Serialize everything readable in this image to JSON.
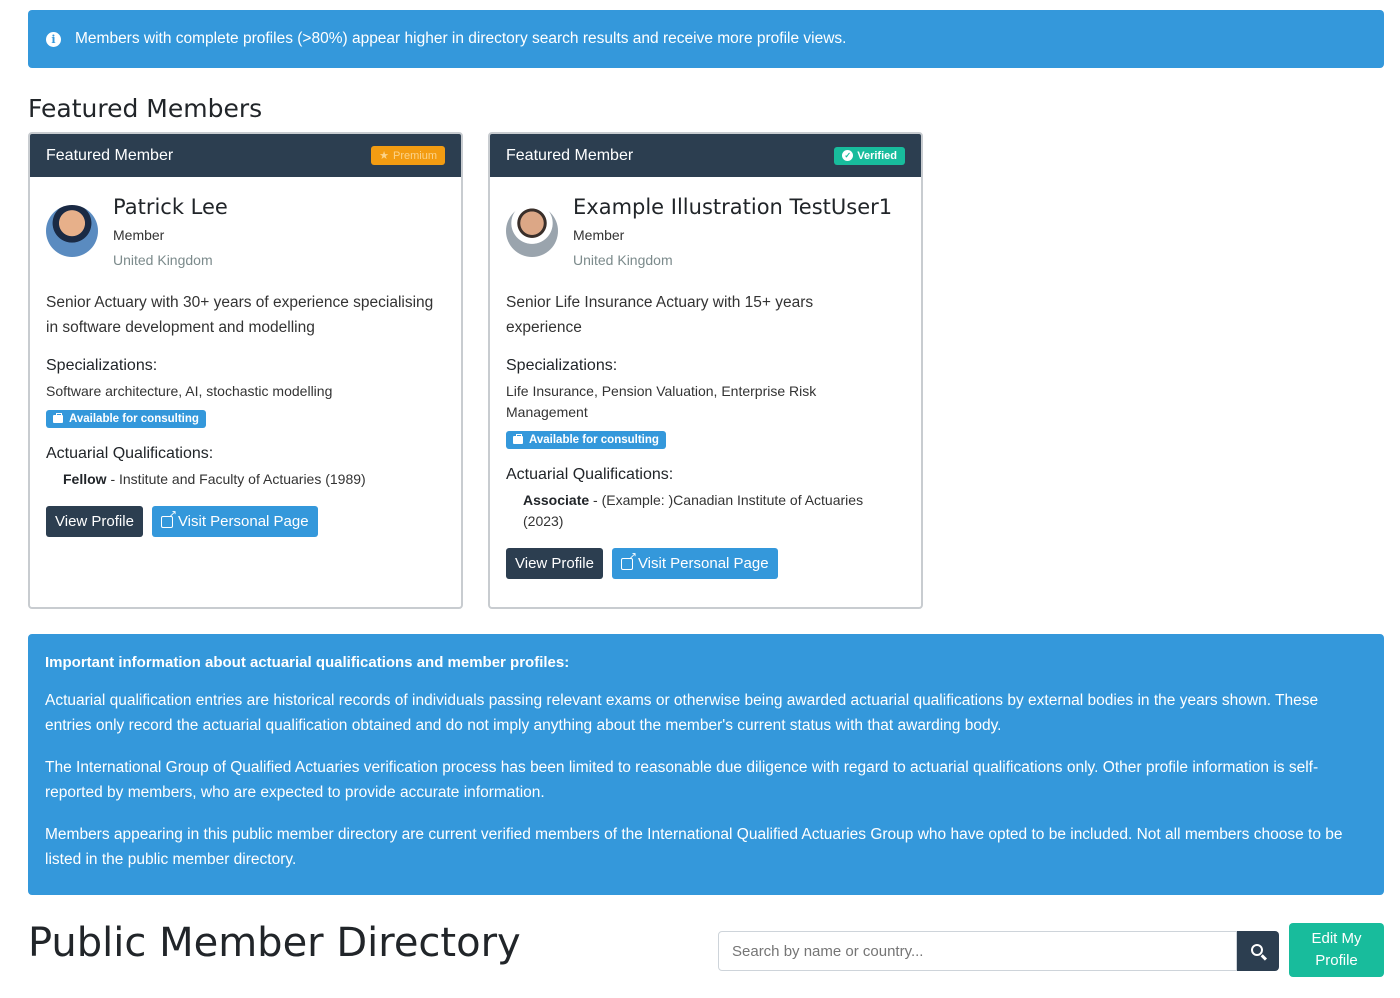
{
  "top_alert": {
    "text": "Members with complete profiles (>80%) appear higher in directory search results and receive more profile views."
  },
  "featured": {
    "title": "Featured Members",
    "cards": [
      {
        "header": "Featured Member",
        "badge": "Premium",
        "name": "Patrick Lee",
        "role": "Member",
        "country": "United Kingdom",
        "bio": "Senior Actuary with 30+ years of experience specialising in software development and modelling",
        "spec_label": "Specializations:",
        "specs": "Software architecture, AI, stochastic modelling",
        "consulting": "Available for consulting",
        "qual_label": "Actuarial Qualifications:",
        "qual_level": "Fellow",
        "qual_detail": " - Institute and Faculty of Actuaries (1989)",
        "view_btn": "View Profile",
        "visit_btn": "Visit Personal Page"
      },
      {
        "header": "Featured Member",
        "badge": "Verified",
        "name": "Example Illustration TestUser1",
        "role": "Member",
        "country": "United Kingdom",
        "bio": "Senior Life Insurance Actuary with 15+ years experience",
        "spec_label": "Specializations:",
        "specs": "Life Insurance, Pension Valuation, Enterprise Risk Management",
        "consulting": "Available for consulting",
        "qual_label": "Actuarial Qualifications:",
        "qual_level": "Associate",
        "qual_detail": " - (Example: )Canadian Institute of Actuaries (2023)",
        "view_btn": "View Profile",
        "visit_btn": "Visit Personal Page"
      }
    ]
  },
  "info_alert": {
    "heading": "Important information about actuarial qualifications and member profiles:",
    "p1": "Actuarial qualification entries are historical records of individuals passing relevant exams or otherwise being awarded actuarial qualifications by external bodies in the years shown. These entries only record the actuarial qualification obtained and do not imply anything about the member's current status with that awarding body.",
    "p2": "The International Group of Qualified Actuaries verification process has been limited to reasonable due diligence with regard to actuarial qualifications only. Other profile information is self-reported by members, who are expected to provide accurate information.",
    "p3": "Members appearing in this public member directory are current verified members of the International Qualified Actuaries Group who have opted to be included. Not all members choose to be listed in the public member directory."
  },
  "directory": {
    "title": "Public Member Directory",
    "search_placeholder": "Search by name or country...",
    "edit_btn": "Edit My\nProfile"
  },
  "colors": {
    "primary": "#3498db",
    "dark": "#2c3e50",
    "success": "#18bc9c",
    "warning": "#f39c12"
  }
}
